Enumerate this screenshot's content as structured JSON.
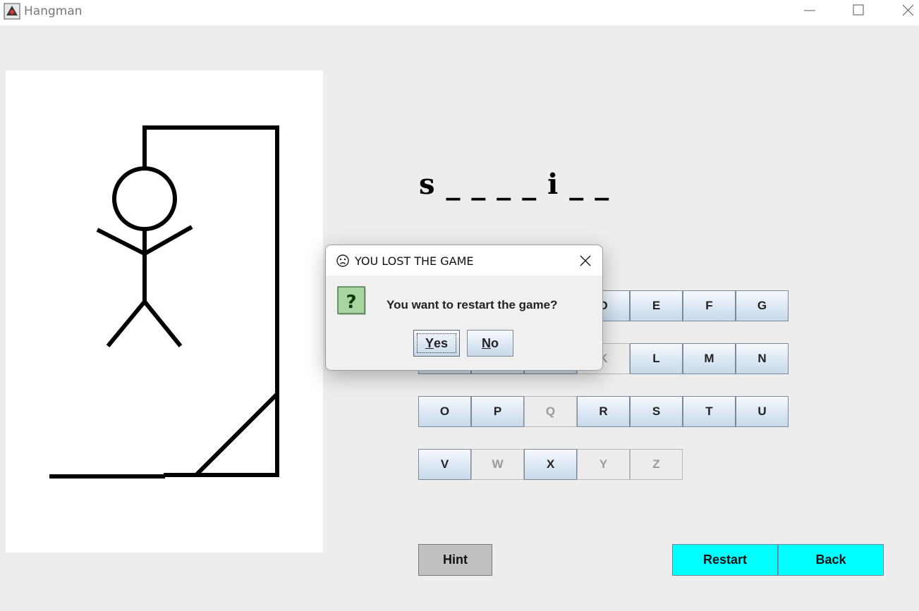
{
  "window": {
    "title": "Hangman"
  },
  "game": {
    "word_display": "s _ _ _ _ i _ _",
    "letters": [
      {
        "letter": "D",
        "state": "enabled"
      },
      {
        "letter": "E",
        "state": "enabled"
      },
      {
        "letter": "F",
        "state": "enabled"
      },
      {
        "letter": "G",
        "state": "enabled"
      },
      {
        "letter": "K",
        "state": "disabled"
      },
      {
        "letter": "L",
        "state": "enabled"
      },
      {
        "letter": "M",
        "state": "enabled"
      },
      {
        "letter": "N",
        "state": "enabled"
      },
      {
        "letter": "O",
        "state": "enabled"
      },
      {
        "letter": "P",
        "state": "enabled"
      },
      {
        "letter": "Q",
        "state": "disabled"
      },
      {
        "letter": "R",
        "state": "enabled"
      },
      {
        "letter": "S",
        "state": "enabled"
      },
      {
        "letter": "T",
        "state": "enabled"
      },
      {
        "letter": "U",
        "state": "enabled"
      },
      {
        "letter": "V",
        "state": "enabled"
      },
      {
        "letter": "W",
        "state": "disabled"
      },
      {
        "letter": "X",
        "state": "enabled"
      },
      {
        "letter": "Y",
        "state": "disabled"
      },
      {
        "letter": "Z",
        "state": "disabled"
      }
    ],
    "hint_label": "Hint",
    "restart_label": "Restart",
    "back_label": "Back"
  },
  "dialog": {
    "title": "YOU LOST THE GAME",
    "title_icon": "sad-face-icon",
    "message_icon": "question-icon",
    "message": "You want to restart the game?",
    "yes_mnemonic": "Y",
    "yes_rest": "es",
    "no_mnemonic": "N",
    "no_rest": "o"
  },
  "colors": {
    "accent_button": "#00ffff",
    "hint_button": "#c0c0c0",
    "background": "#ededed"
  }
}
